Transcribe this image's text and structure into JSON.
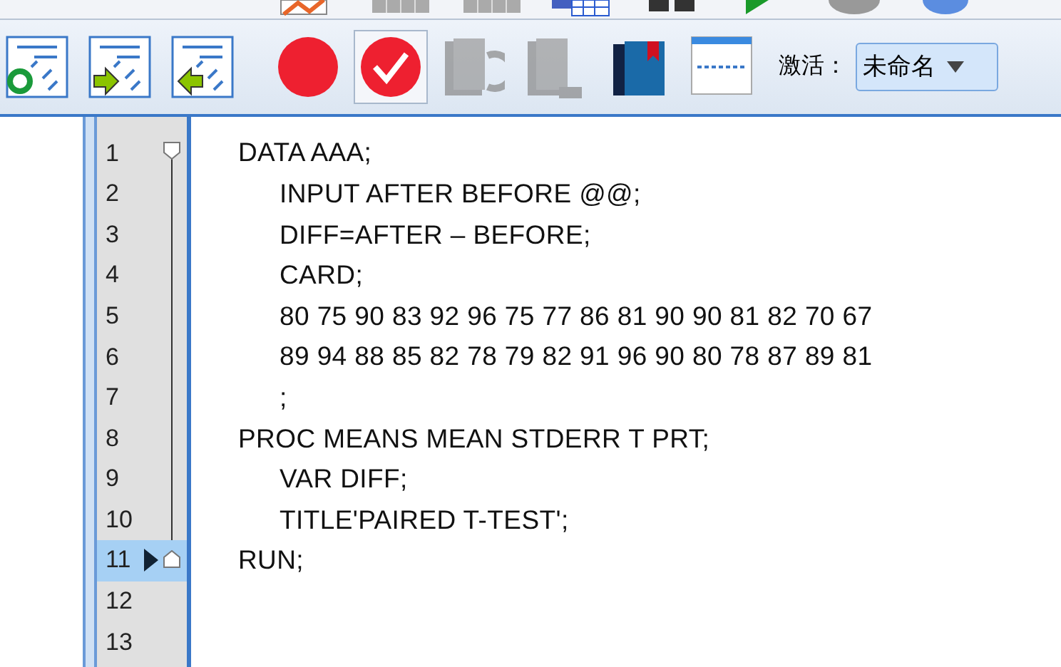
{
  "top_toolbar": [
    {
      "kind": "chart"
    },
    {
      "kind": "grid"
    },
    {
      "kind": "grid"
    },
    {
      "kind": "table"
    },
    {
      "kind": "split"
    },
    {
      "kind": "play"
    },
    {
      "kind": "disc"
    },
    {
      "kind": "ball"
    }
  ],
  "toolbar": {
    "buttons": [
      {
        "kind": "recycle",
        "selected": false,
        "disabled": false
      },
      {
        "kind": "indent",
        "selected": false,
        "disabled": false
      },
      {
        "kind": "outdent",
        "selected": false,
        "disabled": false
      },
      {
        "kind": "record",
        "selected": false,
        "disabled": false
      },
      {
        "kind": "check",
        "selected": true,
        "disabled": false
      },
      {
        "kind": "pages-back",
        "selected": false,
        "disabled": true
      },
      {
        "kind": "pages-forward",
        "selected": false,
        "disabled": true
      },
      {
        "kind": "books",
        "selected": false,
        "disabled": false
      },
      {
        "kind": "page",
        "selected": false,
        "disabled": false
      }
    ],
    "activate_label": "激活：",
    "dataset": {
      "value": "未命名"
    }
  },
  "editor": {
    "lines": [
      {
        "number": "1",
        "code": "DATA AAA;",
        "selected": false,
        "children": [
          {
            "number": "2",
            "code": "INPUT AFTER BEFORE @@;",
            "selected": false
          },
          {
            "number": "3",
            "code": "DIFF=AFTER – BEFORE;",
            "selected": false
          },
          {
            "number": "4",
            "code": "CARD;",
            "selected": false
          },
          {
            "number": "5",
            "code": "80 75 90 83 92 96 75 77 86 81 90 90 81 82 70 67",
            "selected": false
          },
          {
            "number": "6",
            "code": "89 94 88 85 82 78 79 82 91 96 90 80 78 87 89 81",
            "selected": false
          },
          {
            "number": "7",
            "code": ";",
            "selected": false
          }
        ]
      },
      {
        "number": "8",
        "code": "PROC MEANS MEAN STDERR T PRT;",
        "selected": false,
        "children": [
          {
            "number": "9",
            "code": "VAR DIFF;",
            "selected": false
          },
          {
            "number": "10",
            "code": "TITLE'PAIRED T-TEST';",
            "selected": false
          }
        ]
      },
      {
        "number": "11",
        "code": "RUN;",
        "selected": true
      },
      {
        "number": "12",
        "selected": false
      },
      {
        "number": "13",
        "selected": false
      }
    ]
  }
}
